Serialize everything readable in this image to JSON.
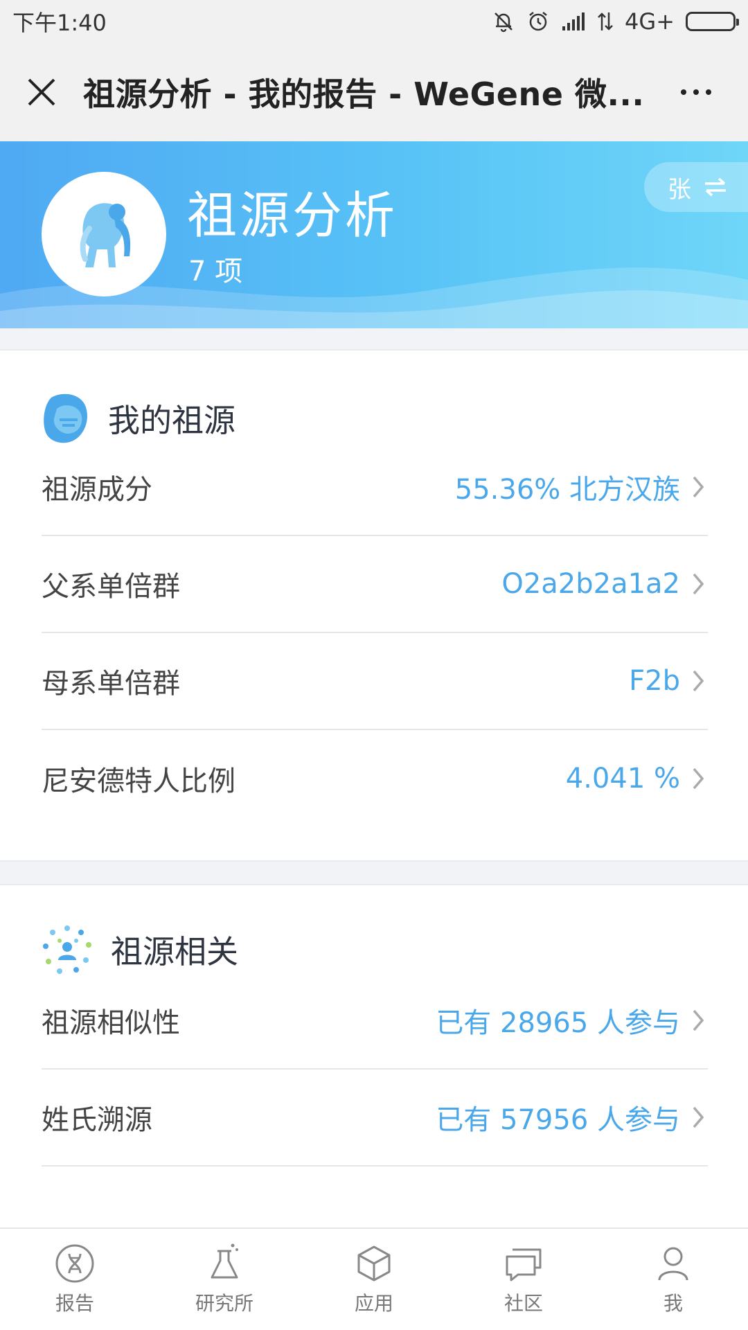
{
  "status_bar": {
    "time": "下午1:40",
    "network": "4G+"
  },
  "title_bar": {
    "title": "祖源分析 - 我的报告 - WeGene 微..."
  },
  "banner": {
    "title": "祖源分析",
    "count": "7 项",
    "switch_label": "张"
  },
  "section_ancestry": {
    "title": "我的祖源",
    "rows": [
      {
        "label": "祖源成分",
        "value": "55.36% 北方汉族"
      },
      {
        "label": "父系单倍群",
        "value": "O2a2b2a1a2"
      },
      {
        "label": "母系单倍群",
        "value": "F2b"
      },
      {
        "label": "尼安德特人比例",
        "value": "4.041 %"
      }
    ]
  },
  "section_related": {
    "title": "祖源相关",
    "rows": [
      {
        "label": "祖源相似性",
        "value": "已有 28965 人参与"
      },
      {
        "label": "姓氏溯源",
        "value": "已有 57956 人参与"
      }
    ]
  },
  "bottom_nav": [
    {
      "label": "报告",
      "icon": "dna-icon"
    },
    {
      "label": "研究所",
      "icon": "flask-icon"
    },
    {
      "label": "应用",
      "icon": "cube-icon"
    },
    {
      "label": "社区",
      "icon": "chat-icon"
    },
    {
      "label": "我",
      "icon": "person-icon"
    }
  ],
  "colors": {
    "accent": "#4aa8ea",
    "banner_start": "#4fa9f3",
    "banner_end": "#6fd6f8"
  }
}
